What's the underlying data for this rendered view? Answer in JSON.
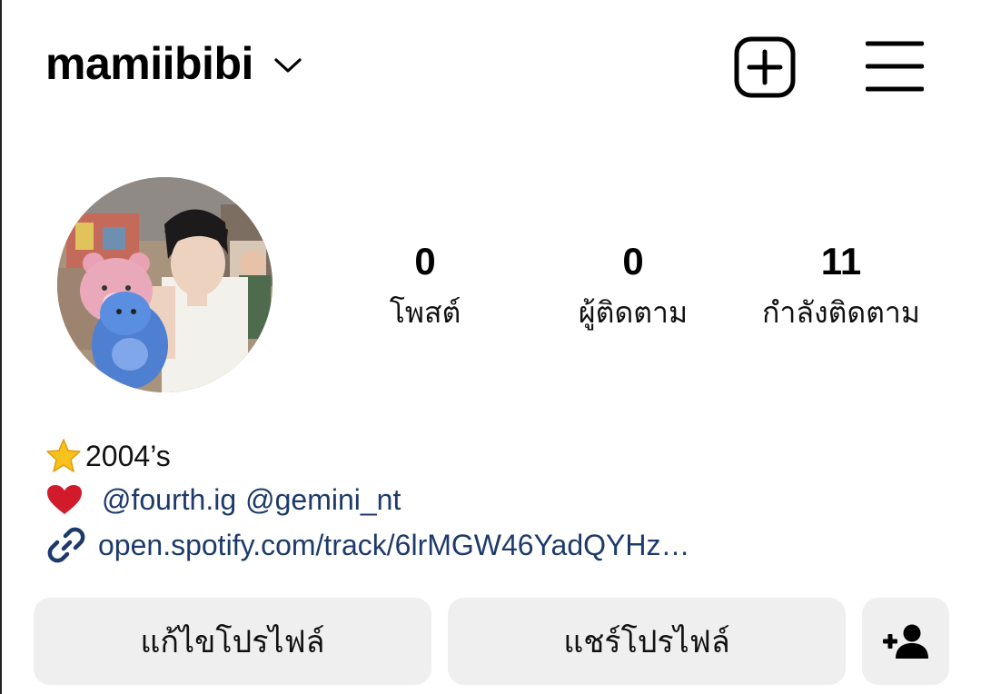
{
  "header": {
    "username": "mamiibibi"
  },
  "stats": {
    "posts": {
      "count": "0",
      "label": "โพสต์"
    },
    "followers": {
      "count": "0",
      "label": "ผู้ติดตาม"
    },
    "following": {
      "count": "11",
      "label": "กำลังติดตาม"
    }
  },
  "bio": {
    "year_text": "2004’s",
    "mentions": [
      "@fourth.ig",
      "@gemini_nt"
    ],
    "link_text": "open.spotify.com/track/6lrMGW46YadQYHz…"
  },
  "buttons": {
    "edit_profile": "แก้ไขโปรไฟล์",
    "share_profile": "แชร์โปรไฟล์"
  },
  "icons": {
    "dropdown": "chevron-down-icon",
    "new_post": "add-square-icon",
    "menu": "hamburger-menu-icon",
    "star": "star-emoji-icon",
    "heart": "heart-emoji-icon",
    "link": "link-icon",
    "add_person": "add-person-icon"
  },
  "colors": {
    "link_blue": "#1d3a6b",
    "button_bg": "#efefef",
    "heart_red": "#d11a2a",
    "star_yellow": "#f7c21b"
  }
}
